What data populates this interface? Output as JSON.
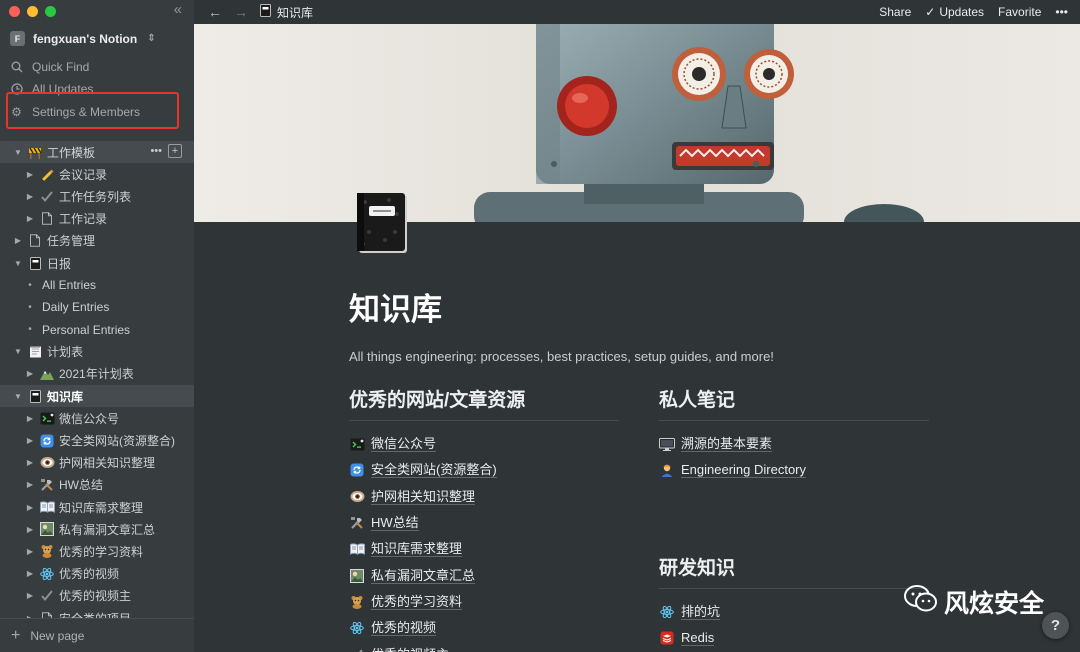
{
  "workspace": {
    "avatar_letter": "F",
    "name": "fengxuan's Notion"
  },
  "nav": {
    "quick_find": "Quick Find",
    "all_updates": "All Updates",
    "settings": "Settings & Members"
  },
  "tree": [
    {
      "label": "工作模板",
      "depth": 0,
      "expanded": true,
      "icon": "construction-sign-icon",
      "hover": true
    },
    {
      "label": "会议记录",
      "depth": 1,
      "expanded": false,
      "icon": "pencil-icon"
    },
    {
      "label": "工作任务列表",
      "depth": 1,
      "expanded": false,
      "icon": "check-mark-icon"
    },
    {
      "label": "工作记录",
      "depth": 1,
      "expanded": false,
      "icon": "page-icon"
    },
    {
      "label": "任务管理",
      "depth": 0,
      "expanded": false,
      "icon": "page-icon"
    },
    {
      "label": "日报",
      "depth": 0,
      "expanded": true,
      "icon": "notebook-icon"
    },
    {
      "label": "All Entries",
      "depth": 1,
      "bullet": true
    },
    {
      "label": "Daily Entries",
      "depth": 1,
      "bullet": true
    },
    {
      "label": "Personal Entries",
      "depth": 1,
      "bullet": true
    },
    {
      "label": "计划表",
      "depth": 0,
      "expanded": true,
      "icon": "spiral-notepad-icon"
    },
    {
      "label": "2021年计划表",
      "depth": 1,
      "expanded": false,
      "icon": "mountain-icon"
    },
    {
      "label": "知识库",
      "depth": 0,
      "expanded": true,
      "icon": "notebook-icon",
      "active": true
    },
    {
      "label": "微信公众号",
      "depth": 1,
      "expanded": false,
      "icon": "terminal-icon"
    },
    {
      "label": "安全类网站(资源整合)",
      "depth": 1,
      "expanded": false,
      "icon": "refresh-icon"
    },
    {
      "label": "护网相关知识整理",
      "depth": 1,
      "expanded": false,
      "icon": "eye-icon"
    },
    {
      "label": "HW总结",
      "depth": 1,
      "expanded": false,
      "icon": "tools-icon"
    },
    {
      "label": "知识库需求整理",
      "depth": 1,
      "expanded": false,
      "icon": "open-book-icon"
    },
    {
      "label": "私有漏洞文章汇总",
      "depth": 1,
      "expanded": false,
      "icon": "photo-icon"
    },
    {
      "label": "优秀的学习资料",
      "depth": 1,
      "expanded": false,
      "icon": "teddy-bear-icon"
    },
    {
      "label": "优秀的视频",
      "depth": 1,
      "expanded": false,
      "icon": "atom-icon"
    },
    {
      "label": "优秀的视频主",
      "depth": 1,
      "expanded": false,
      "icon": "check-mark-icon"
    },
    {
      "label": "安全类的项目",
      "depth": 1,
      "expanded": false,
      "icon": "page-icon"
    }
  ],
  "new_page": "New page",
  "topbar": {
    "breadcrumb": "知识库",
    "share": "Share",
    "updates": "Updates",
    "favorite": "Favorite",
    "more": "•••"
  },
  "page": {
    "title": "知识库",
    "description": "All things engineering: processes, best practices, setup guides, and more!"
  },
  "left_column": {
    "heading": "优秀的网站/文章资源",
    "items": [
      {
        "label": "微信公众号",
        "icon": "terminal-icon"
      },
      {
        "label": "安全类网站(资源整合)",
        "icon": "refresh-icon"
      },
      {
        "label": "护网相关知识整理",
        "icon": "eye-icon"
      },
      {
        "label": "HW总结",
        "icon": "tools-icon"
      },
      {
        "label": "知识库需求整理",
        "icon": "open-book-icon"
      },
      {
        "label": "私有漏洞文章汇总",
        "icon": "photo-icon"
      },
      {
        "label": "优秀的学习资料",
        "icon": "teddy-bear-icon"
      },
      {
        "label": "优秀的视频",
        "icon": "atom-icon"
      },
      {
        "label": "优秀的视频主",
        "icon": "check-mark-icon"
      }
    ]
  },
  "right_column": {
    "heading": "私人笔记",
    "items": [
      {
        "label": "溯源的基本要素",
        "icon": "monitor-icon"
      },
      {
        "label": "Engineering Directory",
        "icon": "person-icon"
      }
    ],
    "heading2": "研发知识",
    "items2": [
      {
        "label": "排的坑",
        "icon": "atom-icon"
      },
      {
        "label": "Redis",
        "icon": "redis-icon"
      }
    ]
  },
  "watermark": "风炫安全",
  "help": "?"
}
